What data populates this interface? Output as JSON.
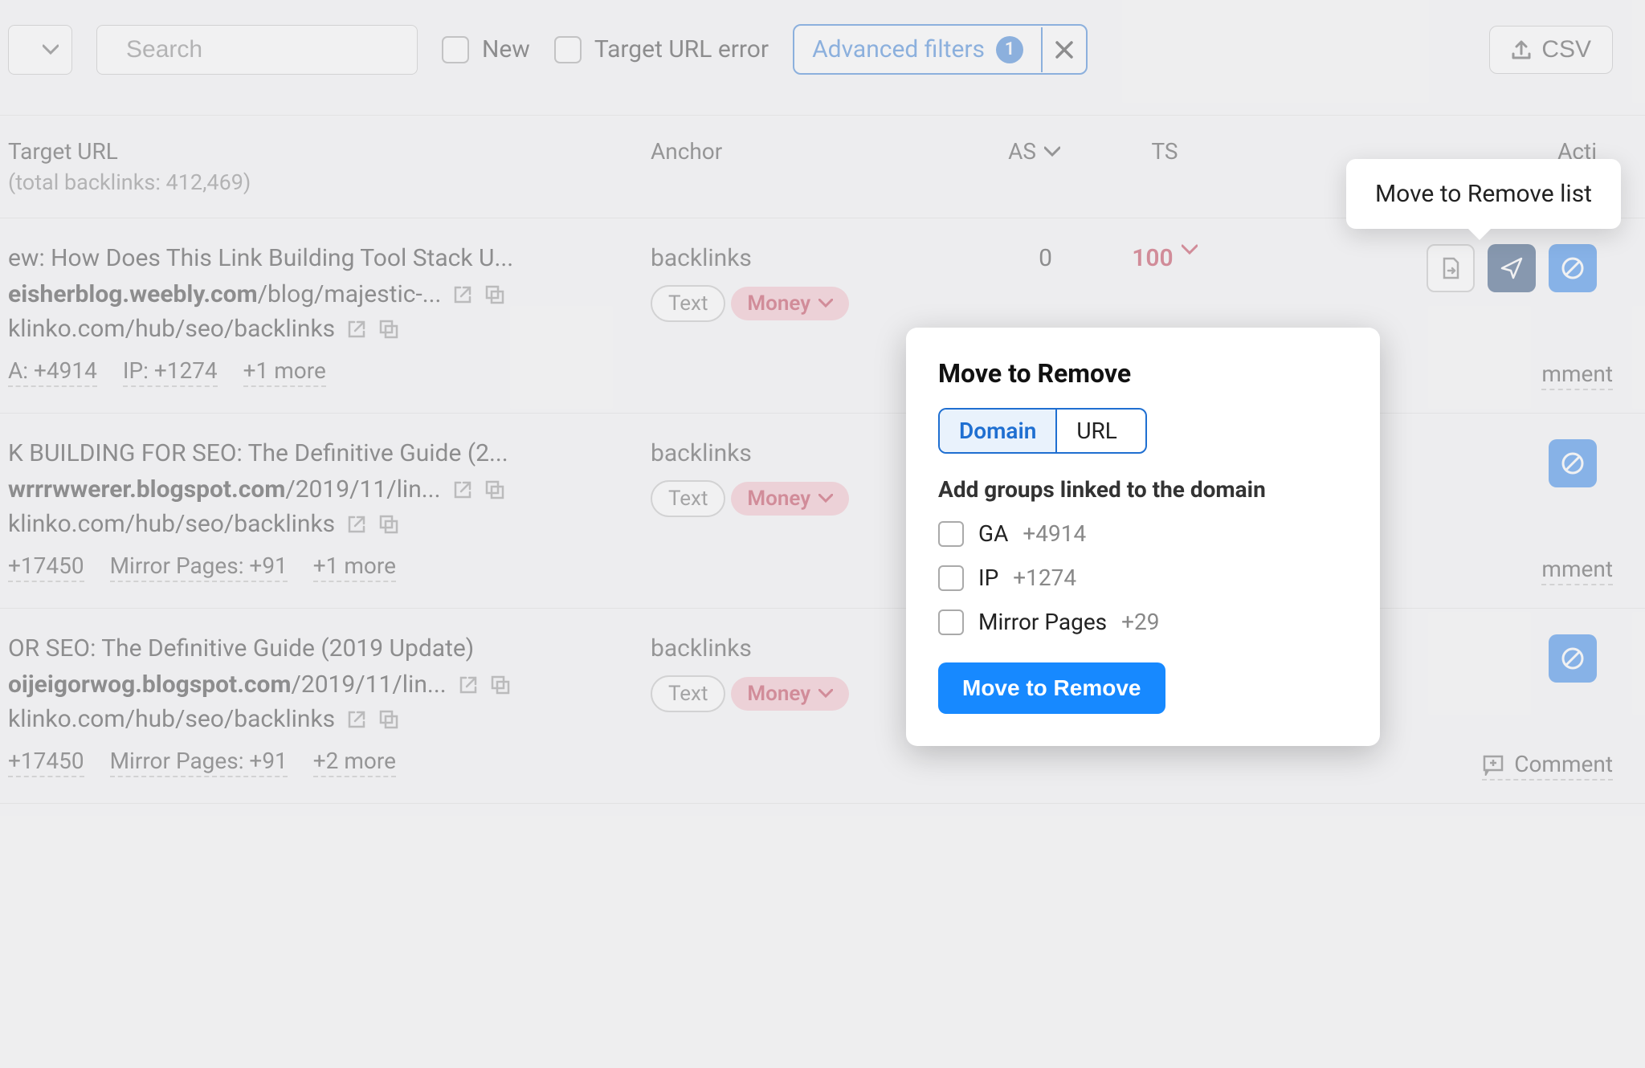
{
  "toolbar": {
    "search_placeholder": "Search",
    "filter_new": "New",
    "filter_target_url_error": "Target URL error",
    "advanced_filters_label": "Advanced filters",
    "advanced_filters_count": "1",
    "csv_label": "CSV"
  },
  "columns": {
    "target_url": "Target URL",
    "total_backlinks_label": "(total backlinks: 412,469)",
    "anchor": "Anchor",
    "as": "AS",
    "ts": "TS",
    "actions": "Acti"
  },
  "tooltip": {
    "text": "Move to Remove list"
  },
  "rows": [
    {
      "title": "ew: How Does This Link Building Tool Stack U...",
      "source_domain": "eisherblog.weebly.com",
      "source_path": "/blog/majestic-...",
      "target": "klinko.com/hub/seo/backlinks",
      "meta": [
        "A: +4914",
        "IP: +1274",
        "+1 more"
      ],
      "anchor": "backlinks",
      "pill_text": "Text",
      "pill_money": "Money",
      "as": "0",
      "ts": "100",
      "comment": "mment"
    },
    {
      "title": "K BUILDING FOR SEO: The Definitive Guide (2...",
      "source_domain": "wrrrwwerer.blogspot.com",
      "source_path": "/2019/11/lin...",
      "target": "klinko.com/hub/seo/backlinks",
      "meta": [
        "+17450",
        "Mirror Pages: +91",
        "+1 more"
      ],
      "anchor": "backlinks",
      "pill_text": "Text",
      "pill_money": "Money",
      "as": "",
      "ts": "",
      "comment": "mment"
    },
    {
      "title": "OR SEO: The Definitive Guide (2019 Update)",
      "source_domain": "oijeigorwog.blogspot.com",
      "source_path": "/2019/11/lin...",
      "target": "klinko.com/hub/seo/backlinks",
      "meta": [
        "+17450",
        "Mirror Pages: +91",
        "+2 more"
      ],
      "anchor": "backlinks",
      "pill_text": "Text",
      "pill_money": "Money",
      "as": "",
      "ts": "",
      "comment": "Comment"
    }
  ],
  "popover": {
    "title": "Move to Remove",
    "seg_domain": "Domain",
    "seg_url": "URL",
    "subheading": "Add groups linked to the domain",
    "groups": [
      {
        "label": "GA",
        "count": "+4914"
      },
      {
        "label": "IP",
        "count": "+1274"
      },
      {
        "label": "Mirror Pages",
        "count": "+29"
      }
    ],
    "button": "Move to Remove"
  }
}
